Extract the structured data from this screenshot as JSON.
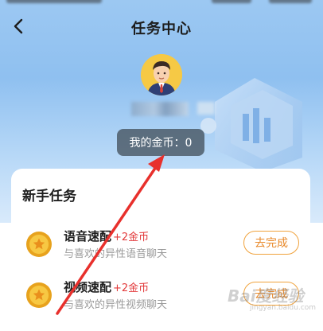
{
  "header": {
    "title": "任务中心",
    "back_icon": "chevron-left-icon"
  },
  "profile": {
    "avatar_icon": "user-avatar-icon",
    "coins_label": "我的金币：0"
  },
  "tasks_section": {
    "title": "新手任务",
    "items": [
      {
        "name": "语音速配",
        "reward": "+2金币",
        "desc": "与喜欢的异性语音聊天",
        "button": "去完成",
        "icon": "coin-icon"
      },
      {
        "name": "视频速配",
        "reward": "+2金币",
        "desc": "与喜欢的异性视频聊天",
        "button": "去完成",
        "icon": "coin-icon"
      }
    ]
  },
  "watermark": {
    "text": "Bai度经验",
    "sub": "jingyan.baidu.com"
  },
  "colors": {
    "accent_orange": "#e8892a",
    "reward_red": "#e2393a",
    "hero_blue": "#9cc8f2",
    "arrow_red": "#e8302c"
  }
}
